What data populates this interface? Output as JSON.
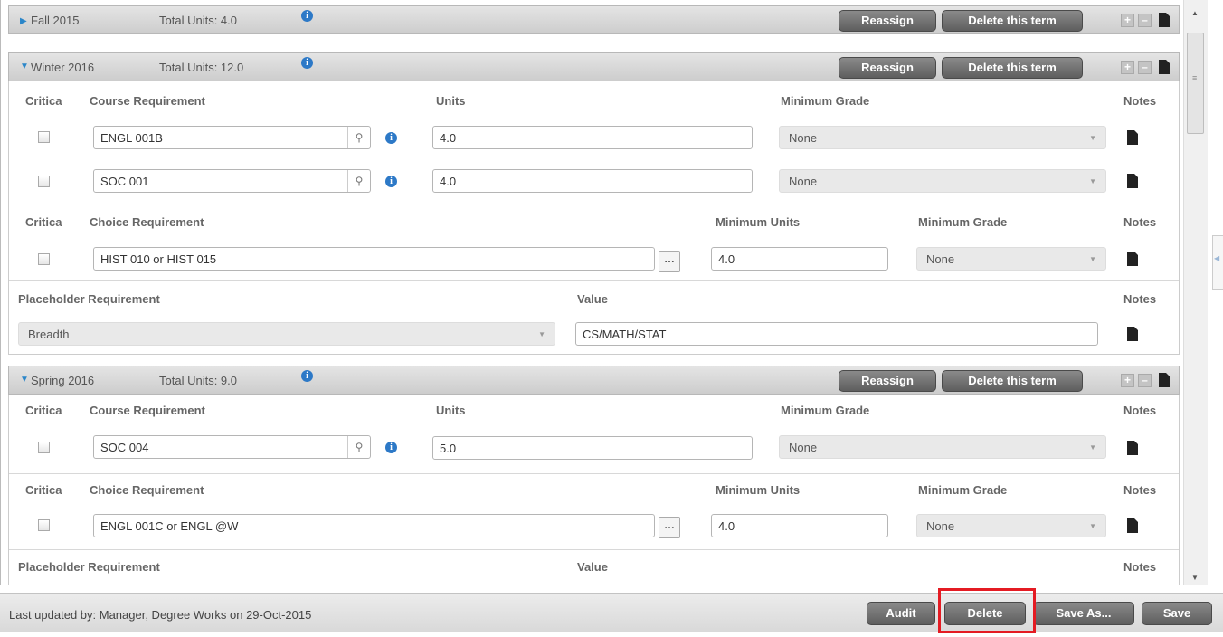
{
  "terms": [
    {
      "name": "Fall 2015",
      "total_units": "Total Units: 4.0",
      "expanded": false,
      "reassign": "Reassign",
      "delete_term": "Delete this term"
    },
    {
      "name": "Winter 2016",
      "total_units": "Total Units: 12.0",
      "expanded": true,
      "reassign": "Reassign",
      "delete_term": "Delete this term",
      "course_section": {
        "col_critical": "Critica",
        "col_req": "Course Requirement",
        "col_units": "Units",
        "col_grade": "Minimum Grade",
        "col_notes": "Notes",
        "rows": [
          {
            "course": "ENGL 001B",
            "units": "4.0",
            "grade": "None"
          },
          {
            "course": "SOC 001",
            "units": "4.0",
            "grade": "None"
          }
        ]
      },
      "choice_section": {
        "col_critical": "Critica",
        "col_req": "Choice Requirement",
        "col_units": "Minimum Units",
        "col_grade": "Minimum Grade",
        "col_notes": "Notes",
        "rows": [
          {
            "choice": "HIST 010 or HIST 015",
            "units": "4.0",
            "grade": "None"
          }
        ]
      },
      "placeholder_section": {
        "col_req": "Placeholder Requirement",
        "col_value": "Value",
        "col_notes": "Notes",
        "rows": [
          {
            "req": "Breadth",
            "value": "CS/MATH/STAT"
          }
        ]
      }
    },
    {
      "name": "Spring 2016",
      "total_units": "Total Units: 9.0",
      "expanded": true,
      "reassign": "Reassign",
      "delete_term": "Delete this term",
      "course_section": {
        "col_critical": "Critica",
        "col_req": "Course Requirement",
        "col_units": "Units",
        "col_grade": "Minimum Grade",
        "col_notes": "Notes",
        "rows": [
          {
            "course": "SOC 004",
            "units": "5.0",
            "grade": "None"
          }
        ]
      },
      "choice_section": {
        "col_critical": "Critica",
        "col_req": "Choice Requirement",
        "col_units": "Minimum Units",
        "col_grade": "Minimum Grade",
        "col_notes": "Notes",
        "rows": [
          {
            "choice": "ENGL 001C or ENGL @W",
            "units": "4.0",
            "grade": "None"
          }
        ]
      },
      "placeholder_section": {
        "col_req": "Placeholder Requirement",
        "col_value": "Value",
        "col_notes": "Notes"
      }
    }
  ],
  "icons": {
    "info": "info-icon",
    "expand": "plus-icon",
    "collapse": "minus-icon",
    "notes": "document-icon",
    "search": "magnifier-icon",
    "choose": "ellipsis-icon"
  },
  "footer": {
    "updated": "Last updated by: Manager, Degree Works on 29-Oct-2015",
    "audit": "Audit",
    "delete": "Delete",
    "save_as": "Save As...",
    "save": "Save"
  },
  "colors": {
    "accent_blue": "#2d79c7",
    "button_gray": "#6e6e6e",
    "highlight_red": "#e41b23"
  }
}
